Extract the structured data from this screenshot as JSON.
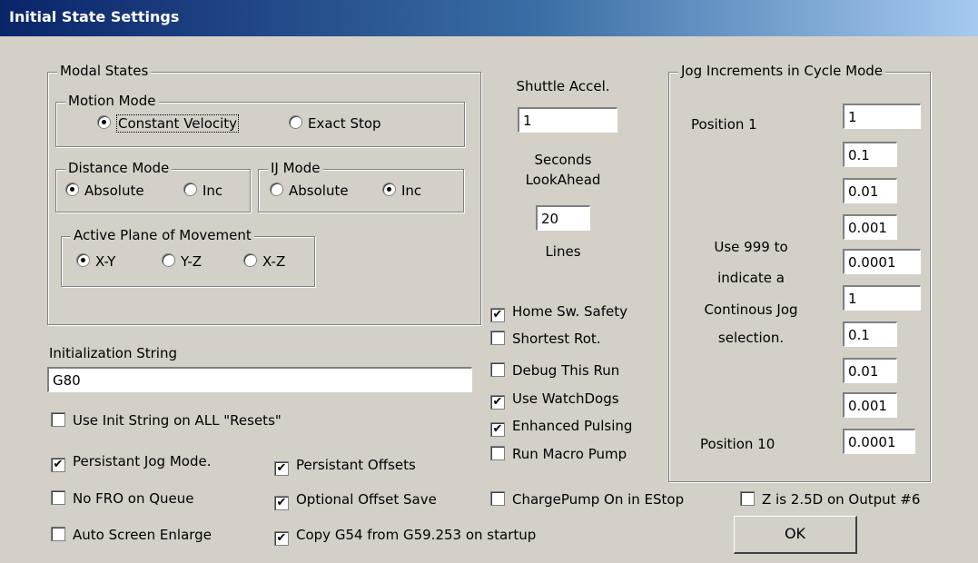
{
  "window": {
    "title": "Initial State Settings"
  },
  "modal": {
    "legend": "Modal States",
    "motion": {
      "legend": "Motion Mode",
      "opt1": "Constant Velocity",
      "opt2": "Exact Stop",
      "selected": "Constant Velocity"
    },
    "distance": {
      "legend": "Distance Mode",
      "opt1": "Absolute",
      "opt2": "Inc",
      "selected": "Absolute"
    },
    "ij": {
      "legend": "IJ Mode",
      "opt1": "Absolute",
      "opt2": "Inc",
      "selected": "Inc"
    },
    "plane": {
      "legend": "Active Plane of Movement",
      "opt1": "X-Y",
      "opt2": "Y-Z",
      "opt3": "X-Z",
      "selected": "X-Y"
    }
  },
  "init": {
    "label": "Initialization String",
    "value": "G80"
  },
  "shuttle": {
    "label": "Shuttle Accel.",
    "value": "1",
    "seconds": "Seconds",
    "lookahead": "LookAhead",
    "lines_value": "20",
    "lines": "Lines"
  },
  "checks": {
    "use_init": "Use Init String on ALL  \"Resets\"",
    "persist_jog": "Persistant Jog Mode.",
    "persist_off": "Persistant Offsets",
    "no_fro": "No FRO on Queue",
    "opt_offset": "Optional Offset Save",
    "chargepump": "ChargePump On in EStop",
    "z25d": "Z is 2.5D on Output #6",
    "auto_enlarge": "Auto Screen Enlarge",
    "copy_g54": "Copy G54 from G59.253 on startup",
    "home_sw": "Home Sw. Safety",
    "shortest": "Shortest Rot.",
    "debug": "Debug This Run",
    "watchdogs": "Use WatchDogs",
    "enhanced": "Enhanced Pulsing",
    "macro_pump": "Run Macro Pump"
  },
  "check_mark": "✔",
  "jog": {
    "legend": "Jog Increments in Cycle Mode",
    "pos1": "Position 1",
    "pos10": "Position 10",
    "note1": "Use 999 to",
    "note2": "indicate a",
    "note3": "Continous Jog",
    "note4": "selection.",
    "values": [
      "1",
      "0.1",
      "0.01",
      "0.001",
      "0.0001",
      "1",
      "0.1",
      "0.01",
      "0.001",
      "0.0001"
    ]
  },
  "ok_label": "OK"
}
